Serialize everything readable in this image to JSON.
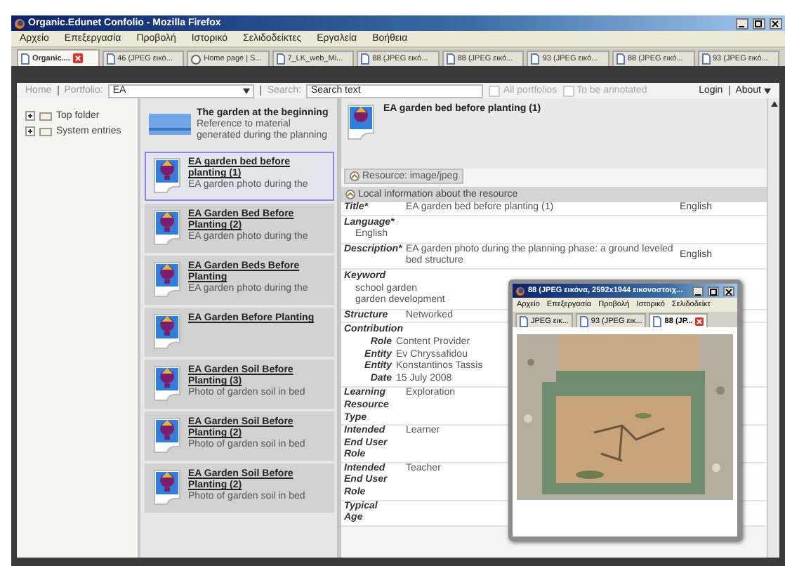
{
  "window": {
    "title": "Organic.Edunet Confolio - Mozilla Firefox"
  },
  "menu": [
    "Αρχείο",
    "Επεξεργασία",
    "Προβολή",
    "Ιστορικό",
    "Σελιδοδείκτες",
    "Εργαλεία",
    "Βοήθεια"
  ],
  "tabs": [
    {
      "label": "Organic....",
      "kind": "page",
      "selected": true
    },
    {
      "label": "46 (JPEG εικό...",
      "kind": "page",
      "selected": false
    },
    {
      "label": "Home page | S...",
      "kind": "home",
      "selected": false
    },
    {
      "label": "7_LK_web_Mi...",
      "kind": "page",
      "selected": false
    },
    {
      "label": "88 (JPEG εικό...",
      "kind": "page",
      "selected": false
    },
    {
      "label": "88 (JPEG εικό...",
      "kind": "page",
      "selected": false
    },
    {
      "label": "93 (JPEG εικό...",
      "kind": "page",
      "selected": false
    },
    {
      "label": "88 (JPEG εικό...",
      "kind": "page",
      "selected": false
    },
    {
      "label": "93 (JPEG εικό...",
      "kind": "page",
      "selected": false
    }
  ],
  "toolbar": {
    "home": "Home",
    "portfolio_label": "Portfolio:",
    "portfolio": "EA",
    "search_label": "Search:",
    "search_value": "Search text",
    "all_portfolios": {
      "label": "All portfolios",
      "checked": false,
      "disabled": true
    },
    "to_be_annotated": {
      "label": "To be annotated",
      "checked": false,
      "disabled": true
    },
    "login": "Login",
    "about": "About"
  },
  "tree": [
    {
      "label": "Top folder",
      "expanded": false
    },
    {
      "label": "System entries",
      "expanded": false
    }
  ],
  "entries": [
    {
      "kind": "folder",
      "title": "The garden at the beginning",
      "description": "Reference to material generated during the planning",
      "selected": false
    },
    {
      "kind": "resource",
      "title": "EA garden bed before planting (1)",
      "description": "EA garden photo during the",
      "selected": true
    },
    {
      "kind": "resource",
      "title": "EA Garden Bed Before Planting (2)",
      "description": "EA garden photo during the",
      "selected": false
    },
    {
      "kind": "resource",
      "title": "EA Garden Beds Before Planting",
      "description": "EA garden photo during the",
      "selected": false
    },
    {
      "kind": "resource",
      "title": "EA Garden Before Planting",
      "selected": false
    },
    {
      "kind": "resource",
      "title": "EA Garden Soil Before Planting (3)",
      "description": "Photo of garden soil in bed",
      "selected": false
    },
    {
      "kind": "resource",
      "title": "EA Garden Soil Before Planting (2)",
      "description": "Photo of garden soil in bed",
      "selected": false
    },
    {
      "kind": "resource",
      "title": "EA Garden Soil Before Planting (2)",
      "description": "Photo of garden soil in bed",
      "selected": false
    }
  ],
  "detail": {
    "title": "EA garden bed before planting (1)",
    "resource_tab": "Resource: image/jpeg",
    "section": "Local information about the resource",
    "fields": [
      {
        "kind": "row",
        "label": "Title*",
        "value": "EA garden bed before planting (1)",
        "language": "English"
      },
      {
        "kind": "stack",
        "label": "Language*",
        "values": [
          "English"
        ]
      },
      {
        "kind": "row",
        "label": "Description*",
        "value": "EA garden photo during the planning phase: a ground leveled bed structure",
        "language": "English"
      },
      {
        "kind": "stack",
        "label": "Keyword",
        "values": [
          "school garden",
          "garden development"
        ]
      },
      {
        "kind": "row",
        "label": "Structure",
        "value": "Networked"
      },
      {
        "kind": "group",
        "label": "Contribution",
        "items": [
          {
            "label": "Role",
            "value": "Content Provider"
          },
          {
            "label": "Entity",
            "value": "Ev Chryssafidou"
          },
          {
            "label": "Entity",
            "value": "Konstantinos Tassis"
          },
          {
            "label": "Date",
            "value": "15 July 2008"
          }
        ]
      },
      {
        "kind": "row",
        "label": "Learning Resource Type",
        "value": "Exploration"
      },
      {
        "kind": "row",
        "label": "Intended End User Role",
        "value": "Learner"
      },
      {
        "kind": "row",
        "label": "Intended End User Role",
        "value": "Teacher"
      },
      {
        "kind": "row",
        "label": "Typical Age"
      }
    ]
  },
  "popup": {
    "title": "88 (JPEG εικόνα, 2592x1944 εικονοστοιχ...",
    "menu": [
      "Αρχείο",
      "Επεξεργασία",
      "Προβολή",
      "Ιστορικό",
      "Σελιδοδείκτ"
    ],
    "tabs": [
      {
        "label": "JPEG εικ...",
        "selected": false
      },
      {
        "label": "93 (JPEG εικ...",
        "selected": false
      },
      {
        "label": "88 (JP...",
        "selected": true
      }
    ]
  }
}
